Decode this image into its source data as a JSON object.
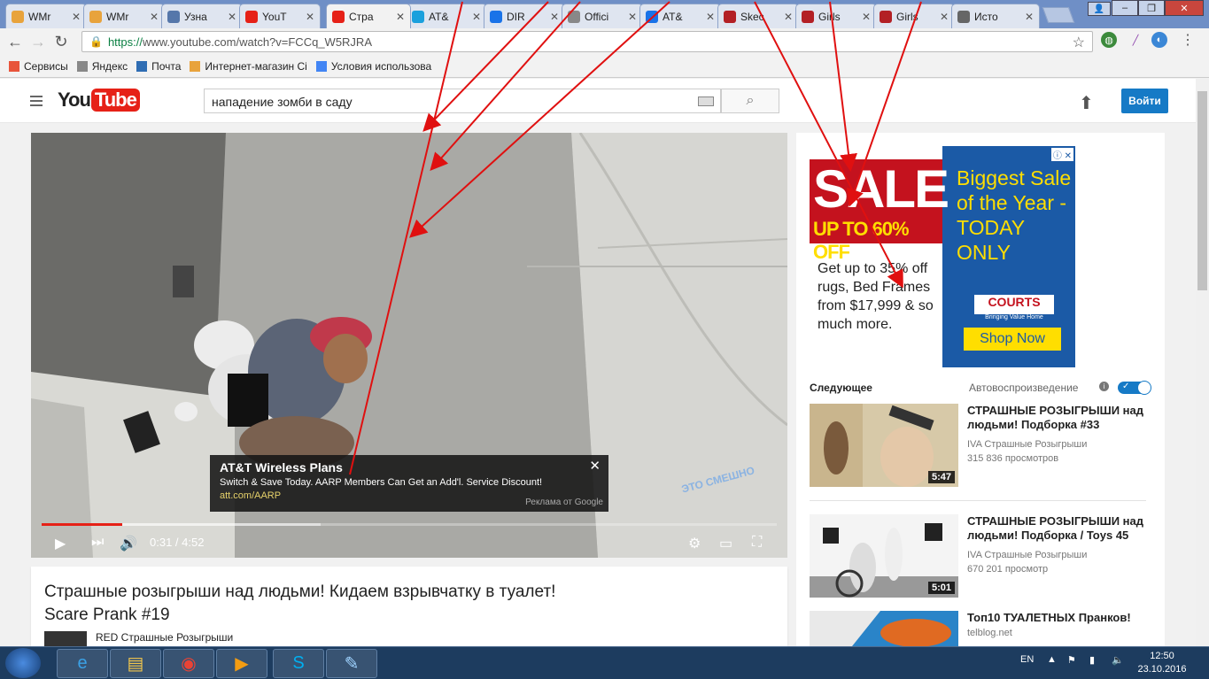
{
  "browser": {
    "tabs": [
      {
        "label": "WMr",
        "icon": "wm-icon",
        "color": "#e8a33c"
      },
      {
        "label": "WMr",
        "icon": "wm-icon",
        "color": "#e8a33c"
      },
      {
        "label": "Узна",
        "icon": "search-icon",
        "color": "#5577aa"
      },
      {
        "label": "YouT",
        "icon": "yandex-icon",
        "color": "#e62117"
      },
      {
        "label": "Стра",
        "icon": "youtube-icon",
        "color": "#e62117"
      },
      {
        "label": "AT&",
        "icon": "att-icon",
        "color": "#1aa0dd"
      },
      {
        "label": "DIR",
        "icon": "loading-icon",
        "color": "#1a73e8"
      },
      {
        "label": "Offici",
        "icon": "page-icon",
        "color": "#888888"
      },
      {
        "label": "AT&",
        "icon": "loading-icon",
        "color": "#1a73e8"
      },
      {
        "label": "Skec",
        "icon": "skechers-icon",
        "color": "#b32025"
      },
      {
        "label": "Girls",
        "icon": "skechers-icon",
        "color": "#b32025"
      },
      {
        "label": "Girls",
        "icon": "skechers-icon",
        "color": "#b32025"
      },
      {
        "label": "Исто",
        "icon": "history-icon",
        "color": "#666666"
      }
    ],
    "url_https": "https://",
    "url_rest": "www.youtube.com/watch?v=FCCq_W5RJRA",
    "bookmarks": [
      {
        "label": "Сервисы",
        "icon": "apps-icon"
      },
      {
        "label": "Яндекс",
        "icon": "page-icon"
      },
      {
        "label": "Почта",
        "icon": "mail-icon"
      },
      {
        "label": "Интернет-магазин Сі",
        "icon": "shop-icon"
      },
      {
        "label": "Условия использова",
        "icon": "google-icon"
      }
    ]
  },
  "youtube": {
    "logo_you": "You",
    "logo_tube": "Tube",
    "search_value": "нападение зомби в саду",
    "signin_label": "Войти",
    "video": {
      "time": "0:31 / 4:52",
      "progress_played": 0.11,
      "progress_loaded": 0.38,
      "watermark": "ЭТО СМЕШНО",
      "overlay_ad": {
        "title": "AT&T Wireless Plans",
        "desc": "Switch & Save Today. AARP Members Can Get an Add'l. Service Discount!",
        "url": "att.com/AARP",
        "by": "Реклама от Google"
      }
    },
    "title": "Страшные розыгрыши над людьми! Кидаем взрывчатку в туалет! Scare Prank #19",
    "channel": "RED Страшные Розыгрыши",
    "ad": {
      "sale": "SALE",
      "upto": "UP TO 60% OFF",
      "body": "Get up to 35% off rugs, Bed Frames from $17,999 & so much more.",
      "headline": "Biggest Sale of the Year - TODAY ONLY",
      "brand": "COURTS",
      "tagline": "Bringing Value Home",
      "cta": "Shop Now"
    },
    "next_label": "Следующее",
    "autoplay_label": "Автовоспроизведение",
    "related": [
      {
        "title": "СТРАШНЫЕ РОЗЫГРЫШИ над людьми! Подборка #33",
        "channel": "IVA Страшные Розыгрыши",
        "views": "315 836 просмотров",
        "duration": "5:47"
      },
      {
        "title": "СТРАШНЫЕ РОЗЫГРЫШИ над людьми! Подборка / Toys 45",
        "channel": "IVA Страшные Розыгрыши",
        "views": "670 201 просмотр",
        "duration": "5:01"
      },
      {
        "title": "Топ10 ТУАЛЕТНЫХ Пранков!",
        "channel": "telblog.net",
        "views": "",
        "duration": ""
      }
    ]
  },
  "taskbar": {
    "apps": [
      "ie-icon",
      "explorer-icon",
      "chrome-icon",
      "media-icon",
      "skype-icon",
      "notepad-icon"
    ],
    "lang": "EN",
    "time": "12:50",
    "date": "23.10.2016"
  }
}
